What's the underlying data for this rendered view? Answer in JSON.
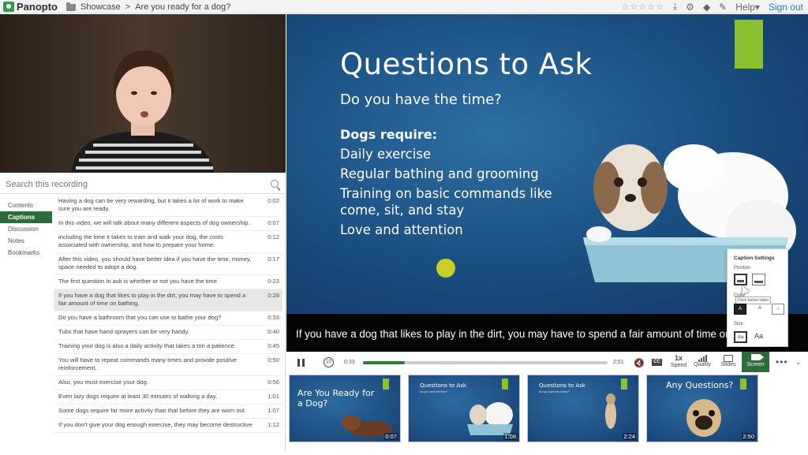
{
  "topbar": {
    "brand": "Panopto",
    "breadcrumb_folder": "Showcase",
    "breadcrumb_sep": ">",
    "breadcrumb_title": "Are you ready for a dog?",
    "stars": "☆☆☆☆☆",
    "help_label": "Help",
    "help_caret": "▾",
    "signout_label": "Sign out"
  },
  "sidebar": {
    "search_placeholder": "Search this recording",
    "tabs": [
      {
        "label": "Contents",
        "active": false
      },
      {
        "label": "Captions",
        "active": true
      },
      {
        "label": "Discussion",
        "active": false
      },
      {
        "label": "Notes",
        "active": false
      },
      {
        "label": "Bookmarks",
        "active": false
      }
    ],
    "captions": [
      {
        "text": "Having a dog can be very rewarding, but it takes a lot of work to make sure you are ready.",
        "time": "0:02"
      },
      {
        "text": "In this video, we will talk about many different aspects of dog ownership.",
        "time": "0:07"
      },
      {
        "text": "including the time it takes to train and walk your dog, the costs associated with ownership, and how to prepare your home.",
        "time": "0:12"
      },
      {
        "text": "After this video, you should have better idea if you have the time, money, space needed to adopt a dog.",
        "time": "0:17"
      },
      {
        "text": "The first question to ask is whether or not you have the time.",
        "time": "0:23"
      },
      {
        "text": "If you have a dog that likes to play in the dirt, you may have to spend a fair amount of time on bathing.",
        "time": "0:28",
        "active": true
      },
      {
        "text": "Do you have a bathroom that you can use to bathe your dog?",
        "time": "0:33"
      },
      {
        "text": "Tubs that have hand sprayers can be very handy.",
        "time": "0:40"
      },
      {
        "text": "Training your dog is also a daily activity that takes a ton a patience.",
        "time": "0:45"
      },
      {
        "text": "You will have to repeat commands many times and provide positive reinforcement.",
        "time": "0:50"
      },
      {
        "text": "Also, you must exercise your dog.",
        "time": "0:56"
      },
      {
        "text": "Even lazy dogs require at least 30 minutes of walking a day.",
        "time": "1:01"
      },
      {
        "text": "Some dogs require far more activity than that before they are worn out.",
        "time": "1:07"
      },
      {
        "text": "If you don't give your dog enough exercise, they may become destructive",
        "time": "1:12"
      }
    ]
  },
  "slide": {
    "title": "Questions to Ask",
    "subtitle": "Do you have the time?",
    "heading": "Dogs require:",
    "bullets": [
      "Daily exercise",
      "Regular bathing and grooming",
      "Training on basic commands like come, sit, and stay",
      "Love and attention"
    ]
  },
  "caption_overlay": "If you have a dog that likes to play in the dirt, you may have to spend a fair amount of time on bathing.",
  "player": {
    "current_time": "0:33",
    "total_time": "2:51",
    "progress": 0.17,
    "rewind_label": "10",
    "mute_icon": "🔇",
    "cc_label": "CC",
    "speed_value": "1x",
    "speed_label": "Speed",
    "quality_label": "Quality",
    "slides_label": "Slides",
    "screen_label": "Screen",
    "more_label": "•••",
    "chevron": "⌄"
  },
  "caption_settings": {
    "title": "Caption Settings",
    "position_label": "Position",
    "color_label": "Color",
    "size_label": "Size",
    "tooltip": "Dock below video",
    "color_options": [
      "A",
      "A",
      "A"
    ],
    "size_options": [
      "Aa",
      "Aa"
    ]
  },
  "thumbnails": [
    {
      "title": "Are You Ready for a Dog?",
      "duration": "0:07"
    },
    {
      "title": "Questions to Ask",
      "sub": "Do you have the time?",
      "duration": "1:08"
    },
    {
      "title": "Questions to Ask",
      "sub": "Do you have the money?",
      "duration": "2:24"
    },
    {
      "title": "Any Questions?",
      "duration": "2:50"
    }
  ],
  "colors": {
    "accent_green": "#2d6b39",
    "slide_accent": "#8bc02f",
    "link": "#2a7bbf"
  }
}
